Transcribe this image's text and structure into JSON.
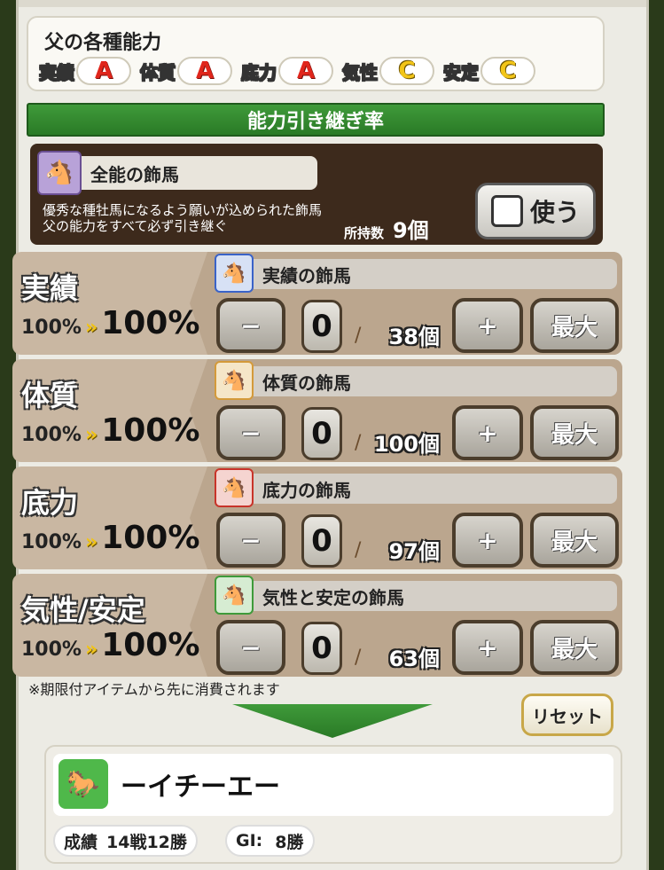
{
  "father": {
    "title": "父の各種能力",
    "abilities": [
      {
        "label": "実績",
        "grade": "A"
      },
      {
        "label": "体質",
        "grade": "A"
      },
      {
        "label": "底力",
        "grade": "A"
      },
      {
        "label": "気性",
        "grade": "C"
      },
      {
        "label": "安定",
        "grade": "C"
      }
    ]
  },
  "inherit_bar": {
    "title": "能力引き継ぎ率"
  },
  "all_item": {
    "name": "全能の飾馬",
    "desc_line1": "優秀な種牡馬になるよう願いが込められた飾馬",
    "desc_line2": "父の能力をすべて必ず引き継ぐ",
    "owned_label": "所持数",
    "owned_count": "9個",
    "use_label": "使う"
  },
  "rows": [
    {
      "title": "実績",
      "from": "100%",
      "arrow": "»",
      "to": "100%",
      "item": "実績の飾馬",
      "qty": "0",
      "cap": "38個",
      "icon_color": "#3a63c8"
    },
    {
      "title": "体質",
      "from": "100%",
      "arrow": "»",
      "to": "100%",
      "item": "体質の飾馬",
      "qty": "0",
      "cap": "100個",
      "icon_color": "#d49a3a"
    },
    {
      "title": "底力",
      "from": "100%",
      "arrow": "»",
      "to": "100%",
      "item": "底力の飾馬",
      "qty": "0",
      "cap": "97個",
      "icon_color": "#c8342a"
    },
    {
      "title": "気性/安定",
      "from": "100%",
      "arrow": "»",
      "to": "100%",
      "item": "気性と安定の飾馬",
      "qty": "0",
      "cap": "63個",
      "icon_color": "#3e9a3a"
    }
  ],
  "buttons": {
    "minus": "−",
    "plus": "+",
    "max": "最大",
    "slash": "/"
  },
  "note": "※期限付アイテムから先に消費されます",
  "reset_label": "リセット",
  "horse": {
    "name": "ーイチーエー",
    "record_label": "成績",
    "record_value": "14戦12勝",
    "gi_label": "GI:",
    "gi_value": "8勝"
  }
}
